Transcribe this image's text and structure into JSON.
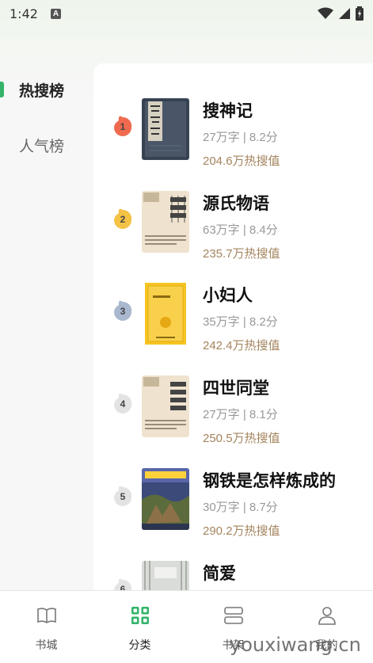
{
  "status": {
    "time": "1:42",
    "badge": "A"
  },
  "sidebar": {
    "items": [
      {
        "label": "热搜榜",
        "active": true
      },
      {
        "label": "人气榜",
        "active": false
      }
    ]
  },
  "books": [
    {
      "rank": "1",
      "title": "搜神记",
      "meta": "27万字 | 8.2分",
      "hot": "204.6万热搜值",
      "badge_color": "#ef6a4f"
    },
    {
      "rank": "2",
      "title": "源氏物语",
      "meta": "63万字 | 8.4分",
      "hot": "235.7万热搜值",
      "badge_color": "#f4c244"
    },
    {
      "rank": "3",
      "title": "小妇人",
      "meta": "35万字 | 8.2分",
      "hot": "242.4万热搜值",
      "badge_color": "#a9b8cf"
    },
    {
      "rank": "4",
      "title": "四世同堂",
      "meta": "27万字 | 8.1分",
      "hot": "250.5万热搜值",
      "badge_color": "#e3e3e3"
    },
    {
      "rank": "5",
      "title": "钢铁是怎样炼成的",
      "meta": "30万字 | 8.7分",
      "hot": "290.2万热搜值",
      "badge_color": "#e3e3e3"
    },
    {
      "rank": "6",
      "title": "简爱",
      "meta": "",
      "hot": "",
      "badge_color": "#e3e3e3"
    }
  ],
  "tabs": [
    {
      "label": "书城",
      "active": false
    },
    {
      "label": "分类",
      "active": true
    },
    {
      "label": "书架",
      "active": false
    },
    {
      "label": "我的",
      "active": false
    }
  ],
  "watermark": "youxiwang.cn",
  "colors": {
    "accent": "#34b36b",
    "hot_text": "#a4845e"
  }
}
